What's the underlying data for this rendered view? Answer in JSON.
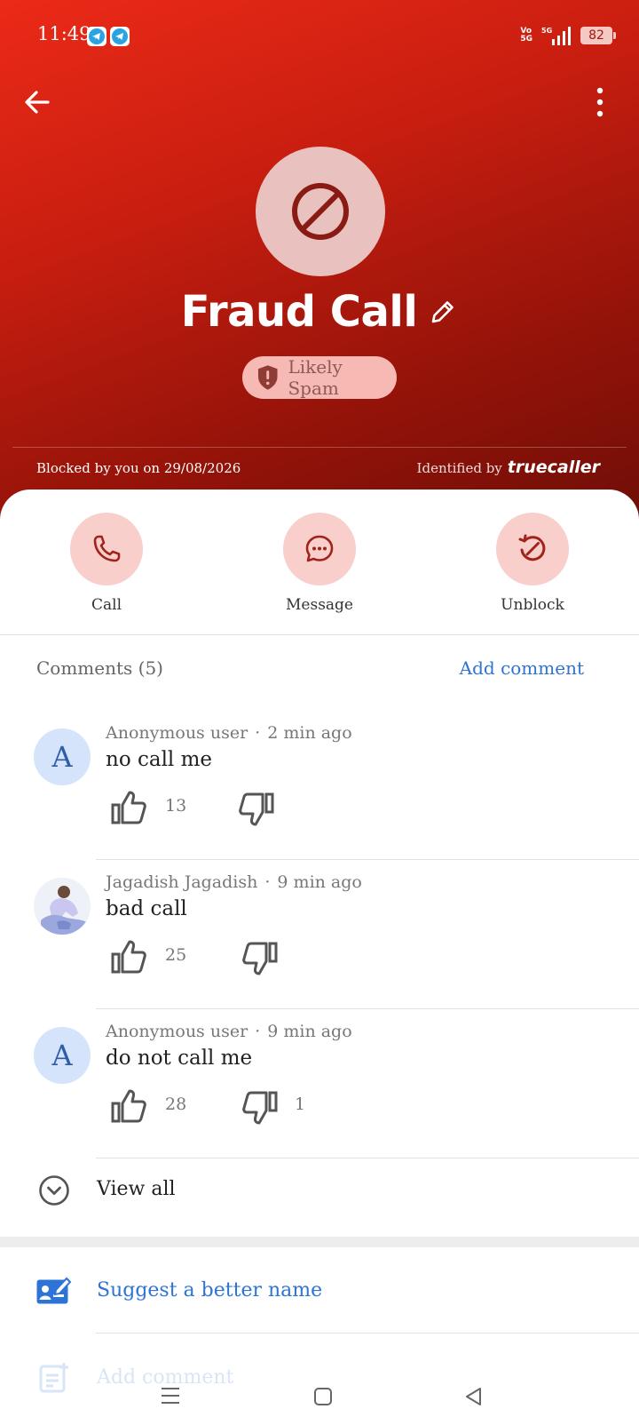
{
  "status_bar": {
    "time": "11:49",
    "network_label": "5G",
    "battery": "82",
    "notification_icons": [
      "telegram-icon",
      "telegram-icon"
    ]
  },
  "contact": {
    "name": "Fraud Call",
    "tag": "Likely Spam",
    "blocked_text": "Blocked by you on 29/08/2026",
    "identified_label": "Identified by",
    "identified_brand": "truecaller"
  },
  "actions": [
    {
      "label": "Call",
      "icon": "phone-icon"
    },
    {
      "label": "Message",
      "icon": "message-icon"
    },
    {
      "label": "Unblock",
      "icon": "unblock-icon"
    }
  ],
  "comments": {
    "title": "Comments (5)",
    "add_label": "Add comment",
    "items": [
      {
        "author": "Anonymous user",
        "time": "2 min ago",
        "text": "no call me",
        "likes": "13",
        "dislikes": "",
        "avatar_letter": "A"
      },
      {
        "author": "Jagadish Jagadish",
        "time": "9 min ago",
        "text": "bad call",
        "likes": "25",
        "dislikes": "",
        "avatar_letter": ""
      },
      {
        "author": "Anonymous user",
        "time": "9 min ago",
        "text": "do not call me",
        "likes": "28",
        "dislikes": "1",
        "avatar_letter": "A"
      }
    ],
    "view_all": "View all"
  },
  "suggest": {
    "label": "Suggest a better name"
  },
  "add_comment_row": {
    "label": "Add comment"
  },
  "colors": {
    "header_red": "#d81f12",
    "accent_blue": "#2d74d6",
    "action_circle": "#f8cfcb"
  }
}
